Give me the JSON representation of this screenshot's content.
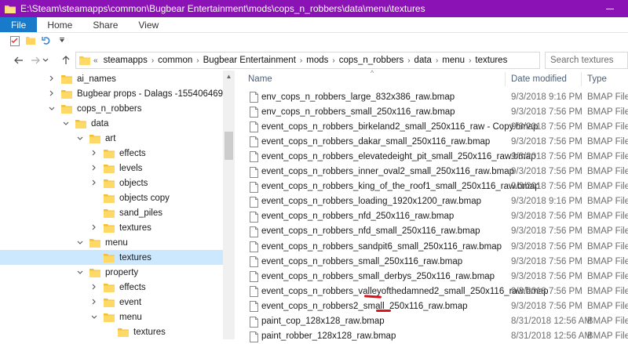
{
  "window": {
    "title": "E:\\Steam\\steamapps\\common\\Bugbear Entertainment\\mods\\cops_n_robbers\\data\\menu\\textures",
    "accent": "#8b12b5"
  },
  "ribbon": {
    "tabs": [
      {
        "label": "File"
      },
      {
        "label": "Home"
      },
      {
        "label": "Share"
      },
      {
        "label": "View"
      }
    ]
  },
  "address": {
    "lead": "«",
    "crumbs": [
      "steamapps",
      "common",
      "Bugbear Entertainment",
      "mods",
      "cops_n_robbers",
      "data",
      "menu",
      "textures"
    ]
  },
  "search": {
    "placeholder": "Search textures"
  },
  "tree": [
    {
      "label": "ai_names",
      "depth": 0,
      "chevron": ">",
      "selected": false
    },
    {
      "label": "Bugbear props - Dalags -1554064696",
      "depth": 0,
      "chevron": ">",
      "selected": false
    },
    {
      "label": "cops_n_robbers",
      "depth": 0,
      "chevron": "v",
      "selected": false
    },
    {
      "label": "data",
      "depth": 1,
      "chevron": "v",
      "selected": false
    },
    {
      "label": "art",
      "depth": 2,
      "chevron": "v",
      "selected": false
    },
    {
      "label": "effects",
      "depth": 3,
      "chevron": ">",
      "selected": false
    },
    {
      "label": "levels",
      "depth": 3,
      "chevron": ">",
      "selected": false
    },
    {
      "label": "objects",
      "depth": 3,
      "chevron": ">",
      "selected": false
    },
    {
      "label": "objects copy",
      "depth": 3,
      "chevron": "",
      "selected": false
    },
    {
      "label": "sand_piles",
      "depth": 3,
      "chevron": "",
      "selected": false
    },
    {
      "label": "textures",
      "depth": 3,
      "chevron": ">",
      "selected": false
    },
    {
      "label": "menu",
      "depth": 2,
      "chevron": "v",
      "selected": false
    },
    {
      "label": "textures",
      "depth": 3,
      "chevron": "",
      "selected": true
    },
    {
      "label": "property",
      "depth": 2,
      "chevron": "v",
      "selected": false
    },
    {
      "label": "effects",
      "depth": 3,
      "chevron": ">",
      "selected": false
    },
    {
      "label": "event",
      "depth": 3,
      "chevron": ">",
      "selected": false
    },
    {
      "label": "menu",
      "depth": 3,
      "chevron": "v",
      "selected": false
    },
    {
      "label": "textures",
      "depth": 4,
      "chevron": "",
      "selected": false
    }
  ],
  "columns": {
    "name": "Name",
    "date": "Date modified",
    "type": "Type"
  },
  "files": [
    {
      "name": "env_cops_n_robbers_large_832x386_raw.bmap",
      "date": "9/3/2018 9:16 PM",
      "type": "BMAP File"
    },
    {
      "name": "env_cops_n_robbers_small_250x116_raw.bmap",
      "date": "9/3/2018 7:56 PM",
      "type": "BMAP File"
    },
    {
      "name": "event_cops_n_robbers_birkeland2_small_250x116_raw - Copy.bmap",
      "date": "9/3/2018 7:56 PM",
      "type": "BMAP File"
    },
    {
      "name": "event_cops_n_robbers_dakar_small_250x116_raw.bmap",
      "date": "9/3/2018 7:56 PM",
      "type": "BMAP File"
    },
    {
      "name": "event_cops_n_robbers_elevatedeight_pit_small_250x116_raw.bmap",
      "date": "9/3/2018 7:56 PM",
      "type": "BMAP File"
    },
    {
      "name": "event_cops_n_robbers_inner_oval2_small_250x116_raw.bmap",
      "date": "9/3/2018 7:56 PM",
      "type": "BMAP File"
    },
    {
      "name": "event_cops_n_robbers_king_of_the_roof1_small_250x116_raw.bmap",
      "date": "9/3/2018 7:56 PM",
      "type": "BMAP File"
    },
    {
      "name": "event_cops_n_robbers_loading_1920x1200_raw.bmap",
      "date": "9/3/2018 9:16 PM",
      "type": "BMAP File"
    },
    {
      "name": "event_cops_n_robbers_nfd_250x116_raw.bmap",
      "date": "9/3/2018 7:56 PM",
      "type": "BMAP File"
    },
    {
      "name": "event_cops_n_robbers_nfd_small_250x116_raw.bmap",
      "date": "9/3/2018 7:56 PM",
      "type": "BMAP File"
    },
    {
      "name": "event_cops_n_robbers_sandpit6_small_250x116_raw.bmap",
      "date": "9/3/2018 7:56 PM",
      "type": "BMAP File"
    },
    {
      "name": "event_cops_n_robbers_small_250x116_raw.bmap",
      "date": "9/3/2018 7:56 PM",
      "type": "BMAP File"
    },
    {
      "name": "event_cops_n_robbers_small_derbys_250x116_raw.bmap",
      "date": "9/3/2018 7:56 PM",
      "type": "BMAP File"
    },
    {
      "name": "event_cops_n_robbers_valleyofthedamned2_small_250x116_raw.bmap",
      "date": "9/3/2018 7:56 PM",
      "type": "BMAP File"
    },
    {
      "name": "event_cops_n_robbers2_small_250x116_raw.bmap",
      "date": "9/3/2018 7:56 PM",
      "type": "BMAP File"
    },
    {
      "name": "paint_cop_128x128_raw.bmap",
      "date": "8/31/2018 12:56 AM",
      "type": "BMAP File"
    },
    {
      "name": "paint_robber_128x128_raw.bmap",
      "date": "8/31/2018 12:56 AM",
      "type": "BMAP File"
    }
  ]
}
